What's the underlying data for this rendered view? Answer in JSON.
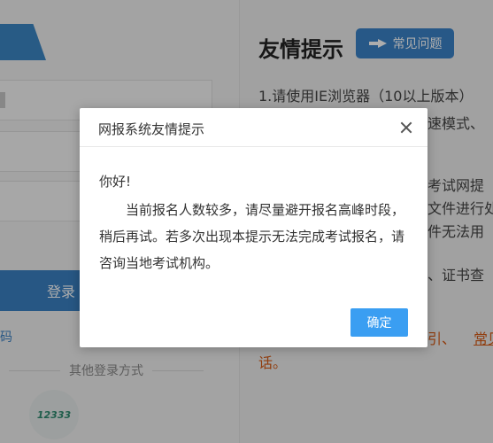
{
  "login_panel": {
    "login_button": "登录",
    "forgot_link": "码",
    "other_login": "其他登录方式",
    "logo_text": "12333"
  },
  "tips": {
    "title": "友情提示",
    "faq_button": "常见问题",
    "lines": [
      "1.请使用IE浏览器（10以上版本）",
      "速模式、",
      "考试网提",
      "文件进行处",
      "件无法用",
      "、证书查",
      "引、",
      "常见",
      "话。"
    ]
  },
  "modal": {
    "title": "网报系统友情提示",
    "greeting": "你好!",
    "message": "当前报名人数较多，请尽量避开报名高峰时段，稍后再试。若多次出现本提示无法完成考试报名，请咨询当地考试机构。",
    "ok_button": "确定"
  },
  "colors": {
    "primary": "#3a81c3",
    "ok_button": "#3a9ef2",
    "link": "#d65a15"
  },
  "icons": {
    "faq": "pointing-hand-icon",
    "close": "close-icon",
    "logo": "social-security-logo-icon"
  }
}
